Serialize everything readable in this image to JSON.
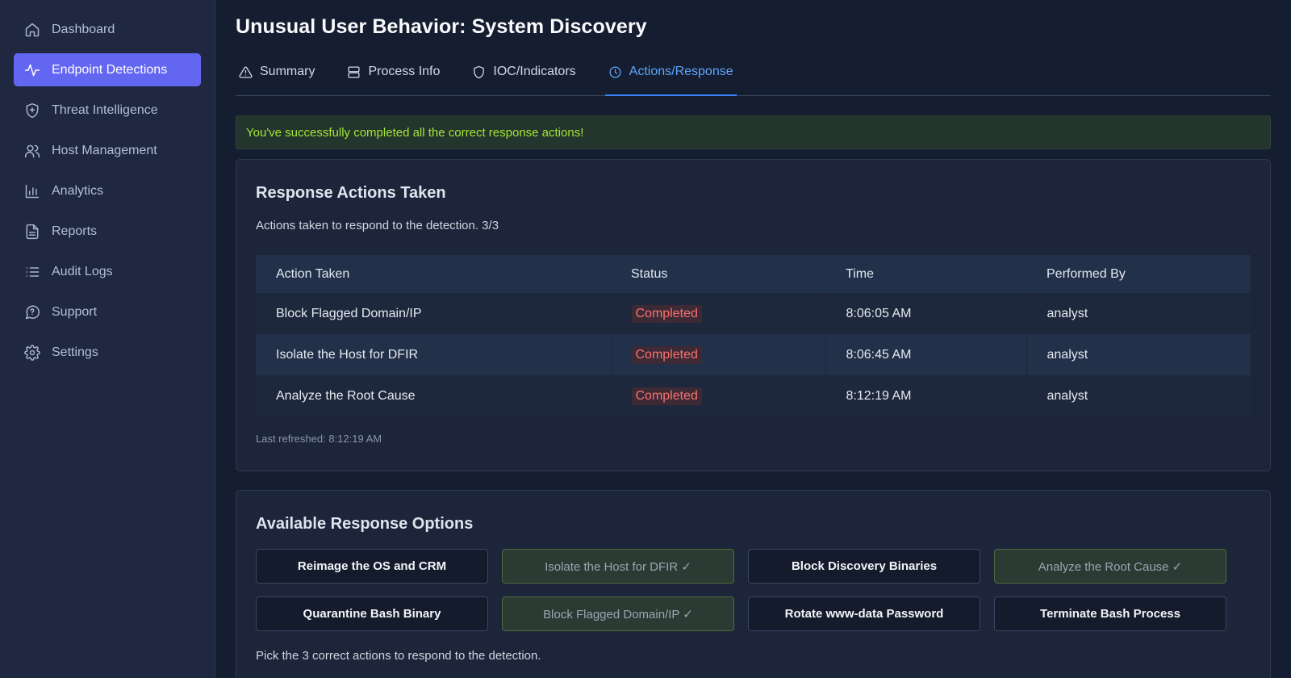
{
  "sidebar": {
    "items": [
      {
        "label": "Dashboard",
        "icon": "home-icon"
      },
      {
        "label": "Endpoint Detections",
        "icon": "activity-icon",
        "active": true
      },
      {
        "label": "Threat Intelligence",
        "icon": "shield-plus-icon"
      },
      {
        "label": "Host Management",
        "icon": "users-icon"
      },
      {
        "label": "Analytics",
        "icon": "bar-chart-icon"
      },
      {
        "label": "Reports",
        "icon": "document-icon"
      },
      {
        "label": "Audit Logs",
        "icon": "list-icon"
      },
      {
        "label": "Support",
        "icon": "chat-icon"
      },
      {
        "label": "Settings",
        "icon": "gear-icon"
      }
    ]
  },
  "header": {
    "title": "Unusual User Behavior: System Discovery"
  },
  "tabs": [
    {
      "label": "Summary",
      "icon": "warning-icon"
    },
    {
      "label": "Process Info",
      "icon": "server-icon"
    },
    {
      "label": "IOC/Indicators",
      "icon": "shield-icon"
    },
    {
      "label": "Actions/Response",
      "icon": "clock-icon",
      "active": true
    }
  ],
  "alert": {
    "message": "You've successfully completed all the correct response actions!"
  },
  "actions_card": {
    "title": "Response Actions Taken",
    "description": "Actions taken to respond to the detection. 3/3",
    "columns": [
      "Action Taken",
      "Status",
      "Time",
      "Performed By"
    ],
    "rows": [
      {
        "action": "Block Flagged Domain/IP",
        "status": "Completed",
        "time": "8:06:05 AM",
        "by": "analyst"
      },
      {
        "action": "Isolate the Host for DFIR",
        "status": "Completed",
        "time": "8:06:45 AM",
        "by": "analyst"
      },
      {
        "action": "Analyze the Root Cause",
        "status": "Completed",
        "time": "8:12:19 AM",
        "by": "analyst"
      }
    ],
    "last_refreshed": "Last refreshed: 8:12:19 AM"
  },
  "options_card": {
    "title": "Available Response Options",
    "options": [
      {
        "label": "Reimage the OS and CRM",
        "done": false
      },
      {
        "label": "Isolate the Host for DFIR ✓",
        "done": true
      },
      {
        "label": "Block Discovery Binaries",
        "done": false
      },
      {
        "label": "Analyze the Root Cause ✓",
        "done": true
      },
      {
        "label": "Quarantine Bash Binary",
        "done": false
      },
      {
        "label": "Block Flagged Domain/IP ✓",
        "done": true
      },
      {
        "label": "Rotate www-data Password",
        "done": false
      },
      {
        "label": "Terminate Bash Process",
        "done": false
      }
    ],
    "hint": "Pick the 3 correct actions to respond to the detection."
  },
  "colors": {
    "accent": "#6366f1",
    "tab_active": "#60a5fa",
    "success_text": "#a3e635",
    "status_red": "#f87171"
  }
}
